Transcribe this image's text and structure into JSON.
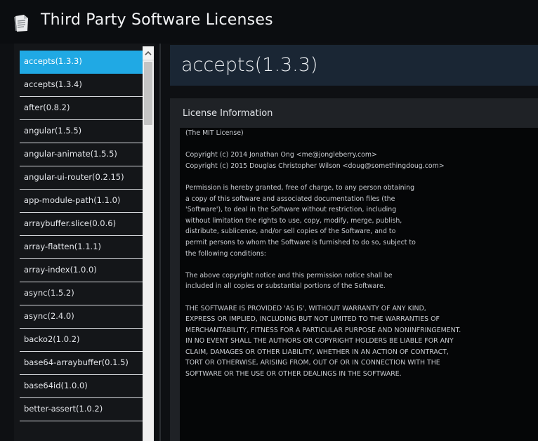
{
  "window": {
    "title": "Third Party Software Licenses",
    "icon": "document-icon"
  },
  "sidebar": {
    "selected_index": 0,
    "items": [
      "accepts(1.3.3)",
      "accepts(1.3.4)",
      "after(0.8.2)",
      "angular(1.5.5)",
      "angular-animate(1.5.5)",
      "angular-ui-router(0.2.15)",
      "app-module-path(1.1.0)",
      "arraybuffer.slice(0.0.6)",
      "array-flatten(1.1.1)",
      "array-index(1.0.0)",
      "async(1.5.2)",
      "async(2.4.0)",
      "backo2(1.0.2)",
      "base64-arraybuffer(0.1.5)",
      "base64id(1.0.0)",
      "better-assert(1.0.2)"
    ]
  },
  "main": {
    "header_title": "accepts(1.3.3)",
    "info_label": "License Information",
    "license_paragraphs": [
      [
        "(The MIT License)"
      ],
      [
        "Copyright (c) 2014 Jonathan Ong <me@jongleberry.com>",
        "Copyright (c) 2015 Douglas Christopher Wilson <doug@somethingdoug.com>"
      ],
      [
        "Permission is hereby granted, free of charge, to any person obtaining",
        "a copy of this software and associated documentation files (the",
        "'Software'), to deal in the Software without restriction, including",
        "without limitation the rights to use, copy, modify, merge, publish,",
        "distribute, sublicense, and/or sell copies of the Software, and to",
        "permit persons to whom the Software is furnished to do so, subject to",
        "the following conditions:"
      ],
      [
        "The above copyright notice and this permission notice shall be",
        "included in all copies or substantial portions of the Software."
      ],
      [
        "THE SOFTWARE IS PROVIDED 'AS IS', WITHOUT WARRANTY OF ANY KIND,",
        "EXPRESS OR IMPLIED, INCLUDING BUT NOT LIMITED TO THE WARRANTIES OF",
        "MERCHANTABILITY, FITNESS FOR A PARTICULAR PURPOSE AND NONINFRINGEMENT.",
        "IN NO EVENT SHALL THE AUTHORS OR COPYRIGHT HOLDERS BE LIABLE FOR ANY",
        "CLAIM, DAMAGES OR OTHER LIABILITY, WHETHER IN AN ACTION OF CONTRACT,",
        "TORT OR OTHERWISE, ARISING FROM, OUT OF OR IN CONNECTION WITH THE",
        "SOFTWARE OR THE USE OR OTHER DEALINGS IN THE SOFTWARE."
      ]
    ]
  },
  "colors": {
    "accent": "#20a9e4",
    "header_bg": "#1a2634",
    "background": "#0e1013"
  }
}
